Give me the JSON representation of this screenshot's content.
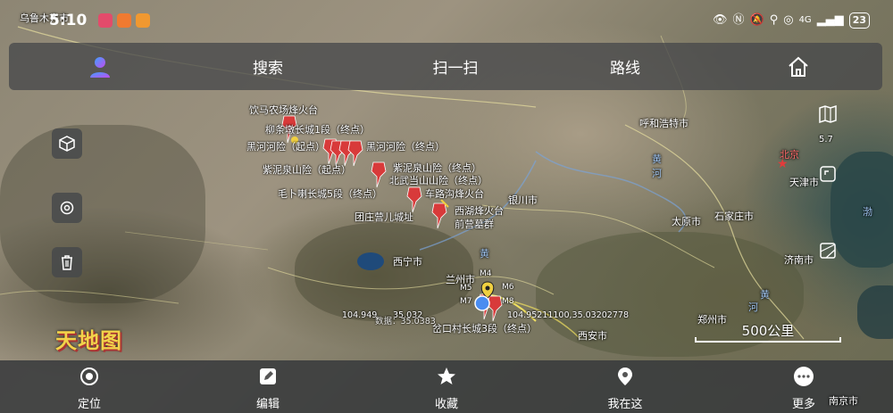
{
  "status": {
    "left_region_label": "乌鲁木齐市",
    "time": "5:10",
    "network": "4G",
    "battery": "23"
  },
  "topbar": {
    "search": "搜索",
    "scan": "扫一扫",
    "route": "路线"
  },
  "map": {
    "zoom_level": "5.7",
    "scale_label": "500公里",
    "coord_a": "104.949",
    "coord_b": "35.032",
    "coord_full": "104.95211100,35.03202778",
    "coord_overlap": "数据：35.0383 ",
    "logo_text": "天地图",
    "markers": {
      "m4": "M4",
      "m5": "M5",
      "m6": "M6",
      "m7": "M7",
      "m8": "M8"
    },
    "poi_labels": {
      "yinmanongchang": "饮马农场烽火台",
      "liutiaodun": "柳条墩长城1段（终点）",
      "heihe_start": "黑河河险（起点）",
      "heihe_end": "黑河河险（终点）",
      "zini_start": "紫泥泉山险（起点）",
      "zini_end": "紫泥泉山险（终点）",
      "beiwudang": "北武当山山险（终点）",
      "maobula": "毛卜喇长城5段（终点）",
      "chelugou": "车路沟烽火台",
      "tuanzhuang": "团庄营儿城址",
      "xihu": "西湖烽火台",
      "qianying": "前营墓群",
      "yankou": "岔口村长城3段（终点）"
    },
    "cities": {
      "huhehaote": "呼和浩特市",
      "beijing": "北京",
      "tianjin": "天津市",
      "yinchuan": "银川市",
      "taiyuan": "太原市",
      "shijiazhuang": "石家庄市",
      "jinan": "济南市",
      "xining": "西宁市",
      "lanzhou": "兰州市",
      "zhengzhou": "郑州市",
      "xian": "西安市",
      "nanjing": "南京市",
      "huanghe_1": "黄",
      "huanghe_2": "河",
      "huanghe_3": "黄",
      "huanghe_4": "黄",
      "huanghe_5": "河",
      "bohai": "渤"
    }
  },
  "bottombar": {
    "locate": "定位",
    "edit": "编辑",
    "favorites": "收藏",
    "where_am_i": "我在这",
    "more": "更多"
  },
  "colors": {
    "pin_red": "#d83a3a",
    "topbar_bg": "#46484a",
    "accent_purple": "#7b5cf0",
    "location_blue": "#4a8df0"
  }
}
